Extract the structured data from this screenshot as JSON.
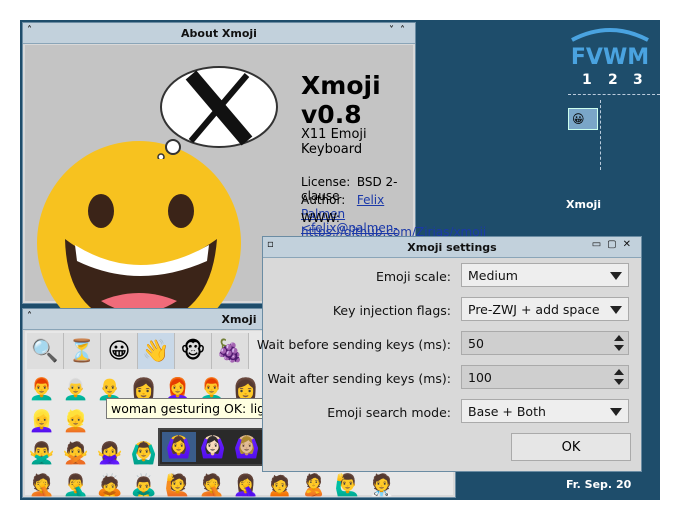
{
  "fvwm": {
    "logo_text": "FVWM",
    "pager_desks": [
      "1",
      "2",
      "3"
    ],
    "task_label": "Xmoji",
    "date": "Fr. Sep. 20"
  },
  "about": {
    "window_title": "About Xmoji",
    "app_name": "Xmoji v0.8",
    "tagline": "X11 Emoji Keyboard",
    "license_label": "License:",
    "license_value": "BSD 2-clause",
    "author_label": "Author:",
    "author_value": "Felix Palmen <felix@palmen-it.de>",
    "www_label": "WWW:",
    "www_value": "https://github.com/Zirias/xmoji",
    "bubble_icon": "x-logo-icon",
    "emoji_icon": "smiling-face-with-thought-bubble"
  },
  "picker": {
    "window_title": "Xmoji",
    "categories": [
      "🔍",
      "⏳",
      "😀",
      "👋",
      "🐵",
      "🍇"
    ],
    "active_category": 3,
    "grid": [
      [
        "👨‍🦰",
        "👨‍🦳",
        "👨‍🦲",
        "👩",
        "👩‍🦰",
        "👨‍🦰",
        "👩",
        "",
        "",
        "",
        "",
        ""
      ],
      [
        "👱‍♀️",
        "👱",
        "",
        "",
        "",
        "",
        "",
        "",
        "",
        "",
        "",
        ""
      ],
      [
        "🙅‍♂️",
        "🙅",
        "🙅‍♀️",
        "🙆‍♂️",
        "",
        "",
        "",
        "",
        "",
        "",
        "",
        ""
      ],
      [
        "🤦",
        "🤦‍♂️",
        "🙇",
        "🙇‍♂️",
        "🙋",
        "🤦",
        "🤦‍♀️",
        "🙍",
        "🙎",
        "🙋‍♂️",
        "🧑‍⚕️",
        ""
      ]
    ],
    "tooltip": "woman gesturing OK: light skin tone",
    "variants": [
      "🙆‍♀️",
      "🙆🏻‍♀️",
      "🙆🏼‍♀️",
      "🙆🏽‍♀️",
      "🙆🏾‍♀️",
      "🙆🏿‍♀️"
    ],
    "selected_variant": 0
  },
  "settings": {
    "window_title": "Xmoji settings",
    "emoji_scale_label": "Emoji scale:",
    "emoji_scale_value": "Medium",
    "key_injection_label": "Key injection flags:",
    "key_injection_value": "Pre-ZWJ + add space",
    "wait_before_label": "Wait before sending keys (ms):",
    "wait_before_value": "50",
    "wait_after_label": "Wait after sending keys (ms):",
    "wait_after_value": "100",
    "search_mode_label": "Emoji search mode:",
    "search_mode_value": "Base + Both",
    "ok_label": "OK"
  }
}
